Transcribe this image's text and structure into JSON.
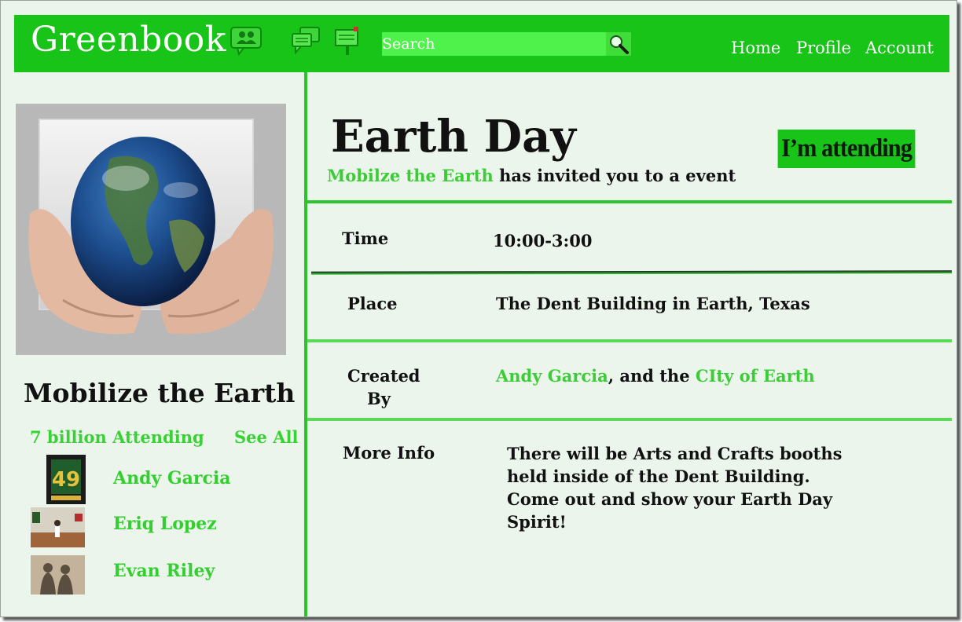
{
  "header": {
    "logo": "Greenbook",
    "search_placeholder": "Search",
    "nav": [
      "Home",
      "Profile",
      "Account"
    ],
    "icons": [
      "friends-icon",
      "messages-icon",
      "events-icon",
      "search-icon"
    ]
  },
  "event": {
    "title": "Earth Day",
    "inviter": "Mobilze the Earth",
    "invite_text": " has invited you to a event",
    "attend_label": "I’m attending",
    "details": {
      "time_label": "Time",
      "time_value": "10:00-3:00",
      "place_label": "Place",
      "place_value": "The Dent Building in Earth, Texas",
      "created_label_1": "Created",
      "created_label_2": "By",
      "creator_1": "Andy Garcia",
      "creator_sep": ", and the ",
      "creator_2": "CIty of Earth",
      "info_label": "More Info",
      "info_text": "There will be Arts and Crafts booths held inside of the Dent Building. Come out and show your Earth Day Spirit!"
    }
  },
  "sidebar": {
    "org_name": "Mobilize the Earth",
    "attending_count": "7 billion Attending",
    "see_all": "See All",
    "attendees": [
      {
        "name": "Andy Garcia"
      },
      {
        "name": "Eriq Lopez"
      },
      {
        "name": "Evan Riley"
      }
    ]
  },
  "colors": {
    "brand_green": "#17c417",
    "link_green": "#3ccd36",
    "background": "#ecf5ec"
  }
}
